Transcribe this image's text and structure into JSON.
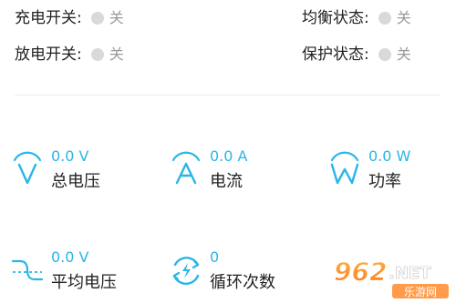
{
  "status": {
    "charge_switch": {
      "label": "充电开关:",
      "value": "关"
    },
    "balance_state": {
      "label": "均衡状态:",
      "value": "关"
    },
    "discharge_switch": {
      "label": "放电开关:",
      "value": "关"
    },
    "protect_state": {
      "label": "保护状态:",
      "value": "关"
    }
  },
  "metrics": {
    "total_voltage": {
      "value": "0.0 V",
      "label": "总电压",
      "icon": "voltage-icon"
    },
    "current": {
      "value": "0.0 A",
      "label": "电流",
      "icon": "current-icon"
    },
    "power": {
      "value": "0.0 W",
      "label": "功率",
      "icon": "power-icon"
    },
    "avg_voltage": {
      "value": "0.0 V",
      "label": "平均电压",
      "icon": "average-voltage-icon"
    },
    "cycle_count": {
      "value": "0",
      "label": "循环次数",
      "icon": "cycle-icon"
    }
  },
  "watermark": {
    "text": "962.NET",
    "subtext": "乐游网"
  },
  "colors": {
    "accent": "#29b6e8",
    "toggle_off": "#d9d9d9",
    "muted_text": "#9a9a9a",
    "divider": "#eeeeee"
  }
}
